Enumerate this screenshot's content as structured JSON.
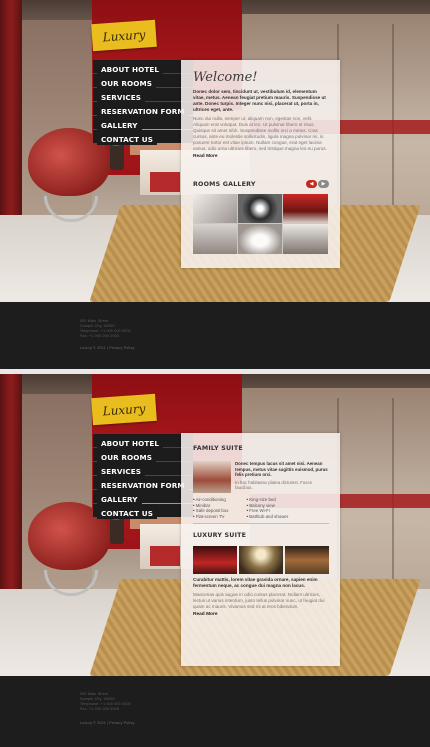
{
  "logo": {
    "text": "Luxury"
  },
  "nav": [
    "ABOUT HOTEL",
    "OUR ROOMS",
    "SERVICES",
    "RESERVATION FORM",
    "GALLERY",
    "CONTACT US"
  ],
  "home": {
    "heading": "Welcome!",
    "intro": "Donec dolor sem, tincidunt ut, vestibulum id, elementum vitae, metus. Aenean feugiat pretium mauris. Suspendisse ut ante. Donec turpis. Integer nunc nisi, placerat ut, porta in, ultrices eget, ante.",
    "body": "Nunc dui nulla, semper ut, aliquam non, egestas non, velit. Aliquam erat volutpat. Duis at leo. Ut pulvinar libero et risus. Quisque sit amet nibh. Suspendisse mollis orci a metus. Cras cursus, ante eu molestie sollicitudin, ligula magna pulvinar mi, in posuere tortor est vitae ipsum. Nullam congue, erat eget lacinia varius, odio urna ultricies libero, sed tristique magna leo eu purus.",
    "read_more": "Read More",
    "gallery_title": "ROOMS GALLERY"
  },
  "rooms": {
    "family_title": "FAMILY SUITE",
    "family_intro": "Donec tempus lacus sit amet nisi. Aenean tempus, metus vitae sagittis euismod, purus felis pretium orci.",
    "family_more": "In hac habitasse platea dictumst. Fusce faucibus.",
    "list_left": [
      "Air-conditioning",
      "Minibar",
      "Safe deposit box",
      "Flat-screen TV"
    ],
    "list_right": [
      "King-size bed",
      "Balcony view",
      "Free Wi-Fi",
      "Bathtub and shower"
    ],
    "luxury_title": "LUXURY SUITE",
    "luxury_intro": "Curabitur mattis, lorem vitae gravida ornare, sapien enim fermentum neque, ac congue dui magna non lacus.",
    "luxury_body": "Maecenas quis augue in odio cursus placerat. Nullam ultricies, lectus ut varius interdum, justo tellus pulvinar nunc, ut feugiat dui quam ac mauris. Vivamus sed mi at eros bibendum.",
    "read_more": "Read More"
  },
  "footer": {
    "address_lines": [
      "000 Main Street",
      "Sample City, 00000",
      "Telephone: +1 000 000 0000",
      "Fax: +1 000 000 0000"
    ],
    "copyright": "Luxury © 2011 | Privacy Policy"
  },
  "colors": {
    "accent": "#c4281e",
    "logo_bg": "#e9bd1d",
    "nav_bg": "#1c1c1c",
    "footer_bg": "#1d1d1d"
  }
}
